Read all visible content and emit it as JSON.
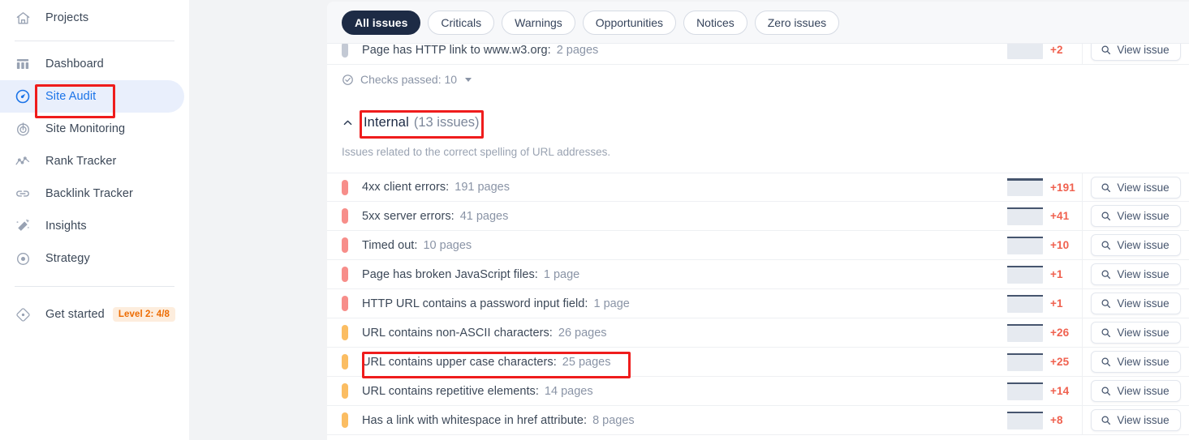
{
  "sidebar": {
    "projects": {
      "label": "Projects",
      "icon": "home-icon"
    },
    "items": [
      {
        "label": "Dashboard",
        "icon": "dashboard-icon",
        "active": false
      },
      {
        "label": "Site Audit",
        "icon": "gauge-icon",
        "active": true
      },
      {
        "label": "Site Monitoring",
        "icon": "radar-icon",
        "active": false
      },
      {
        "label": "Rank Tracker",
        "icon": "line-chart-icon",
        "active": false
      },
      {
        "label": "Backlink Tracker",
        "icon": "link-icon",
        "active": false
      },
      {
        "label": "Insights",
        "icon": "magic-wand-icon",
        "active": false
      },
      {
        "label": "Strategy",
        "icon": "target-icon",
        "active": false
      }
    ],
    "get_started": {
      "label": "Get started",
      "icon": "rocket-diamond-icon",
      "badge": "Level 2: 4/8",
      "badge_color": "#ed6c02"
    }
  },
  "filters": {
    "items": [
      {
        "label": "All issues",
        "active": true
      },
      {
        "label": "Criticals",
        "active": false
      },
      {
        "label": "Warnings",
        "active": false
      },
      {
        "label": "Opportunities",
        "active": false
      },
      {
        "label": "Notices",
        "active": false
      },
      {
        "label": "Zero issues",
        "active": false
      }
    ]
  },
  "clipped_row": {
    "severity": "notice",
    "name": "Page has HTTP link to www.w3.org:",
    "count": "2 pages",
    "delta": "+2",
    "button": "View issue"
  },
  "checks_passed": {
    "label": "Checks passed: 10",
    "icon": "check-circle-icon"
  },
  "section": {
    "title": "Internal",
    "count": "(13 issues)",
    "description": "Issues related to the correct spelling of URL addresses.",
    "collapse_icon": "chevron-up-icon"
  },
  "issue_rows": [
    {
      "severity": "critical",
      "name": "4xx client errors:",
      "count": "191 pages",
      "delta": "+191",
      "button": "View issue"
    },
    {
      "severity": "critical",
      "name": "5xx server errors:",
      "count": "41 pages",
      "delta": "+41",
      "button": "View issue"
    },
    {
      "severity": "critical",
      "name": "Timed out:",
      "count": "10 pages",
      "delta": "+10",
      "button": "View issue"
    },
    {
      "severity": "critical",
      "name": "Page has broken JavaScript files:",
      "count": "1 page",
      "delta": "+1",
      "button": "View issue"
    },
    {
      "severity": "critical",
      "name": "HTTP URL contains a password input field:",
      "count": "1 page",
      "delta": "+1",
      "button": "View issue"
    },
    {
      "severity": "warning",
      "name": "URL contains non-ASCII characters:",
      "count": "26 pages",
      "delta": "+26",
      "button": "View issue"
    },
    {
      "severity": "warning",
      "name": "URL contains upper case characters:",
      "count": "25 pages",
      "delta": "+25",
      "button": "View issue"
    },
    {
      "severity": "warning",
      "name": "URL contains repetitive elements:",
      "count": "14 pages",
      "delta": "+14",
      "button": "View issue"
    },
    {
      "severity": "warning",
      "name": "Has a link with whitespace in href attribute:",
      "count": "8 pages",
      "delta": "+8",
      "button": "View issue"
    }
  ],
  "annotations": {
    "color": "#ef1c1c",
    "boxes": [
      {
        "target": "sidebar-item-site-audit"
      },
      {
        "target": "section-title-internal"
      },
      {
        "target": "issue-row-url-upper-case"
      }
    ]
  }
}
